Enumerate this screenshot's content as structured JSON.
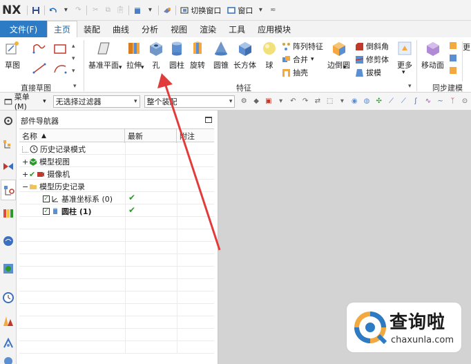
{
  "app": {
    "logo": "NX"
  },
  "quick_access": {
    "switch_window": "切换窗口",
    "window": "窗口"
  },
  "ribbon_tabs": [
    {
      "label": "文件(F)",
      "kind": "file"
    },
    {
      "label": "主页",
      "active": true
    },
    {
      "label": "装配"
    },
    {
      "label": "曲线"
    },
    {
      "label": "分析"
    },
    {
      "label": "视图"
    },
    {
      "label": "渲染"
    },
    {
      "label": "工具"
    },
    {
      "label": "应用模块"
    }
  ],
  "ribbon": {
    "sketch_group": {
      "sketch": "草图",
      "group_label": "直接草图"
    },
    "feature_group": {
      "datum_plane": "基准平面",
      "extrude": "拉伸",
      "hole": "孔",
      "cylinder": "圆柱",
      "revolve": "旋转",
      "cone": "圆锥",
      "block": "长方体",
      "sphere": "球",
      "pattern_feature": "阵列特征",
      "unite": "合并",
      "shell": "抽壳",
      "edge_blend": "边倒圆",
      "chamfer": "倒斜角",
      "trim_body": "修剪体",
      "draft": "拔模",
      "more": "更多",
      "group_label": "特征"
    },
    "sync_group": {
      "move_face": "移动面",
      "group_label": "同步建模"
    }
  },
  "filterbar": {
    "menu": "菜单(M)",
    "type_filter": "无选择过滤器",
    "scope_filter": "整个装配"
  },
  "navigator": {
    "title": "部件导航器",
    "columns": [
      "名称",
      "最新",
      "附注"
    ],
    "rows": [
      {
        "label": "历史记录模式",
        "indent": 1,
        "latest": false
      },
      {
        "label": "模型视图",
        "indent": 0,
        "latest": false
      },
      {
        "label": "摄像机",
        "indent": 0,
        "latest": false
      },
      {
        "label": "模型历史记录",
        "indent": 0,
        "latest": false
      },
      {
        "label": "基准坐标系 (0)",
        "indent": 2,
        "latest": true
      },
      {
        "label": "圆柱 (1)",
        "indent": 2,
        "latest": true,
        "bold": true
      }
    ]
  },
  "watermark": {
    "text": "查询啦",
    "url": "chaxunla.com"
  },
  "colors": {
    "file_tab": "#2d7bc4",
    "graphics_bg": "#d3d3d3",
    "arrow": "#e23b3b",
    "check": "#2a9a2a"
  }
}
